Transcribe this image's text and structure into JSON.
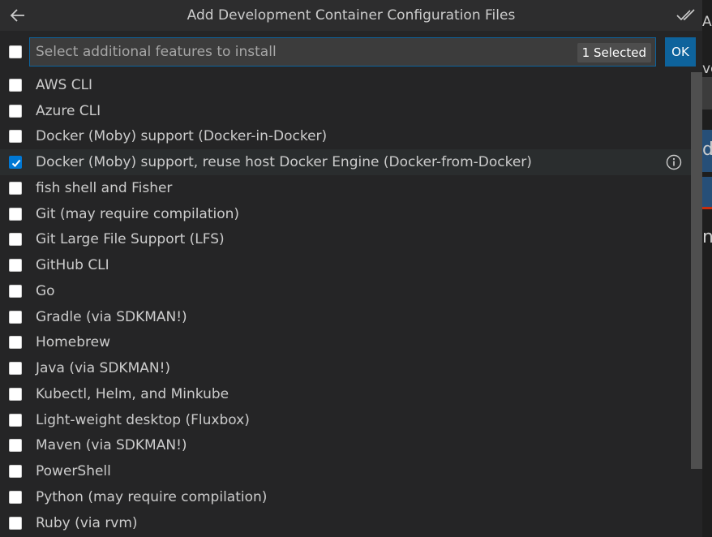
{
  "window": {
    "title": "Add Development Container Configuration Files"
  },
  "icons": {
    "back": "arrow-left-icon",
    "check_all": "check-all-icon",
    "info": "info-icon"
  },
  "colors": {
    "accent": "#0e639c",
    "checkbox_checked": "#0078d4",
    "panel_bg": "#252526"
  },
  "input": {
    "placeholder": "Select additional features to install",
    "value": ""
  },
  "selected_count_label": "1 Selected",
  "ok_label": "OK",
  "background_fragments": [
    "A",
    "ve",
    "d",
    "ne"
  ],
  "items": [
    {
      "label": "AWS CLI",
      "checked": false
    },
    {
      "label": "Azure CLI",
      "checked": false
    },
    {
      "label": "Docker (Moby) support (Docker-in-Docker)",
      "checked": false
    },
    {
      "label": "Docker (Moby) support, reuse host Docker Engine (Docker-from-Docker)",
      "checked": true,
      "focused": true
    },
    {
      "label": "fish shell and Fisher",
      "checked": false
    },
    {
      "label": "Git (may require compilation)",
      "checked": false
    },
    {
      "label": "Git Large File Support (LFS)",
      "checked": false
    },
    {
      "label": "GitHub CLI",
      "checked": false
    },
    {
      "label": "Go",
      "checked": false
    },
    {
      "label": "Gradle (via SDKMAN!)",
      "checked": false
    },
    {
      "label": "Homebrew",
      "checked": false
    },
    {
      "label": "Java (via SDKMAN!)",
      "checked": false
    },
    {
      "label": "Kubectl, Helm, and Minkube",
      "checked": false
    },
    {
      "label": "Light-weight desktop (Fluxbox)",
      "checked": false
    },
    {
      "label": "Maven (via SDKMAN!)",
      "checked": false
    },
    {
      "label": "PowerShell",
      "checked": false
    },
    {
      "label": "Python (may require compilation)",
      "checked": false
    },
    {
      "label": "Ruby (via rvm)",
      "checked": false
    }
  ]
}
